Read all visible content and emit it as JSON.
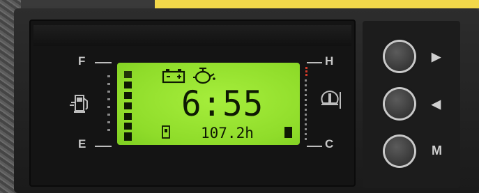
{
  "gauges": {
    "fuel": {
      "full_label": "F",
      "empty_label": "E",
      "icon": "fuel-pump-icon"
    },
    "temperature": {
      "hot_label": "H",
      "cold_label": "C",
      "icon": "coolant-temperature-icon"
    }
  },
  "lcd": {
    "time": "6:55",
    "hours": "107.2h",
    "indicator_icons": [
      "battery-icon",
      "oil-pressure-icon",
      "fuel-can-icon"
    ]
  },
  "buttons": {
    "next_symbol": "▶",
    "prev_symbol": "◀",
    "mode_label": "M"
  }
}
